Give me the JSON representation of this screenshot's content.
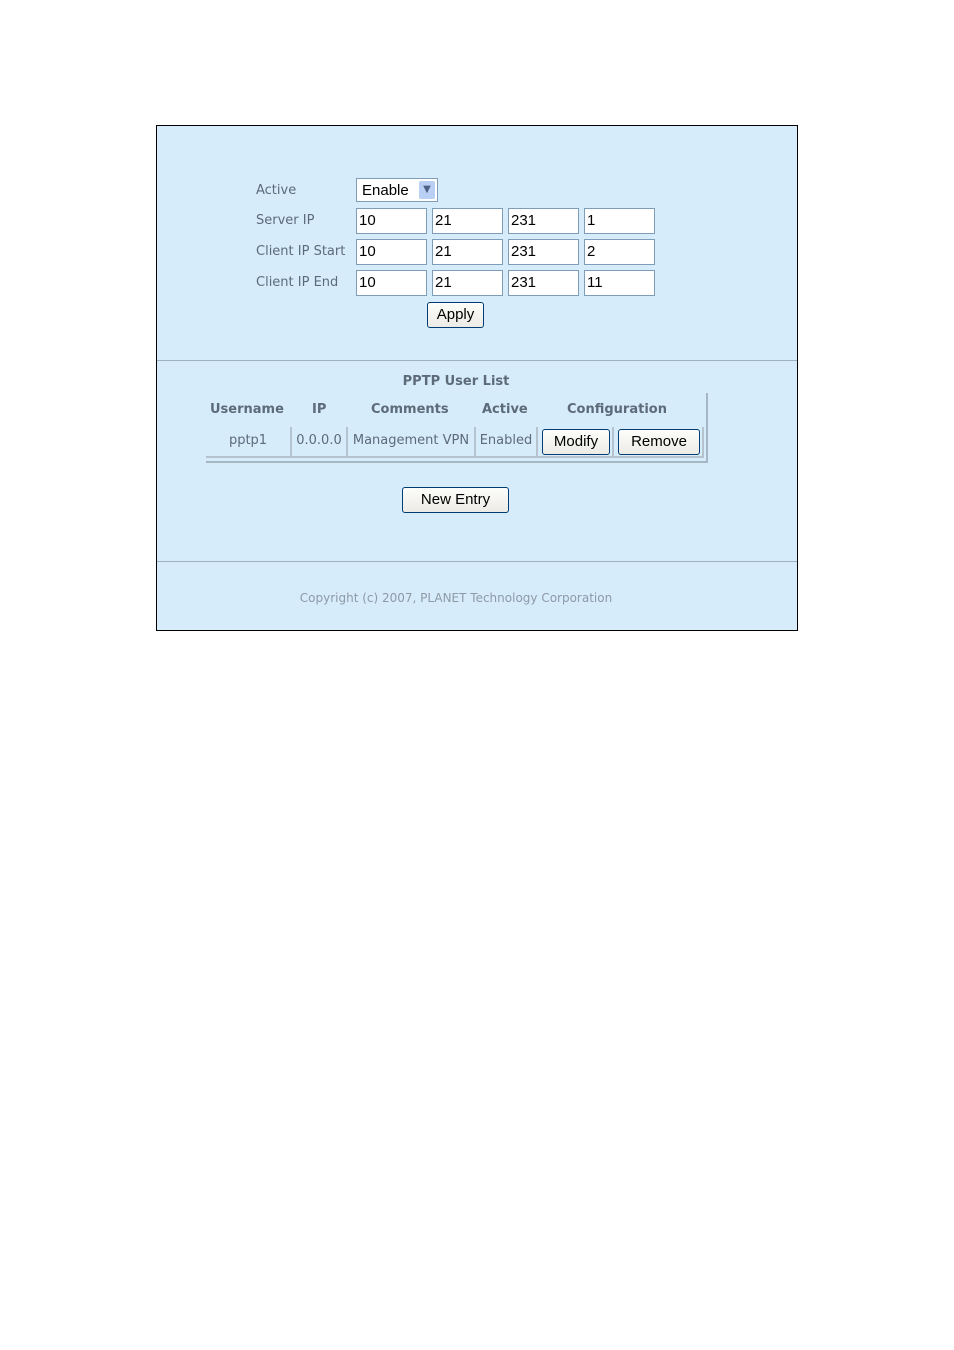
{
  "settings": {
    "active_label": "Active",
    "active_value": "Enable",
    "server_ip_label": "Server IP",
    "server_ip": [
      "10",
      "21",
      "231",
      "1"
    ],
    "client_start_label": "Client IP Start",
    "client_start": [
      "10",
      "21",
      "231",
      "2"
    ],
    "client_end_label": "Client IP End",
    "client_end": [
      "10",
      "21",
      "231",
      "11"
    ],
    "apply_label": "Apply"
  },
  "user_list": {
    "title": "PPTP User List",
    "columns": [
      "Username",
      "IP",
      "Comments",
      "Active",
      "Configuration"
    ],
    "rows": [
      {
        "username": "pptp1",
        "ip": "0.0.0.0",
        "comments": "Management VPN",
        "active": "Enabled",
        "modify_label": "Modify",
        "remove_label": "Remove"
      }
    ],
    "new_entry_label": "New Entry"
  },
  "footer": {
    "copyright": "Copyright (c) 2007, PLANET Technology Corporation"
  }
}
